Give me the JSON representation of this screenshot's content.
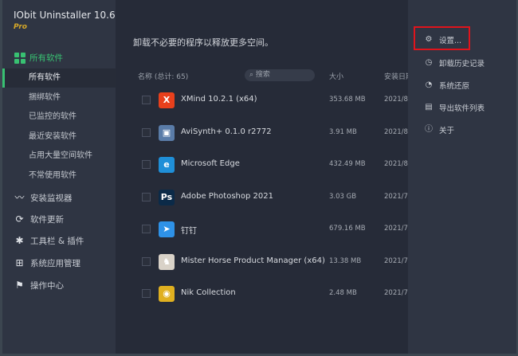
{
  "app": {
    "title": "IObit Uninstaller 10.6",
    "edition": "Pro"
  },
  "sidebar": {
    "group": "所有软件",
    "sub_items": [
      "所有软件",
      "捆绑软件",
      "已监控的软件",
      "最近安装软件",
      "占用大量空间软件",
      "不常使用软件"
    ],
    "items": [
      {
        "label": "安装监视器",
        "icon": "chart-icon"
      },
      {
        "label": "软件更新",
        "icon": "refresh-icon"
      },
      {
        "label": "工具栏 & 插件",
        "icon": "puzzle-icon"
      },
      {
        "label": "系统应用管理",
        "icon": "windows-icon"
      },
      {
        "label": "操作中心",
        "icon": "flag-icon"
      }
    ]
  },
  "main": {
    "description": "卸载不必要的程序以释放更多空间。",
    "columns": {
      "name": "名称 (总计: 65)",
      "search_placeholder": "搜索",
      "size": "大小",
      "date": "安装日期"
    },
    "rows": [
      {
        "name": "XMind 10.2.1 (x64)",
        "size": "353.68 MB",
        "date": "2021/8/",
        "icon": "X",
        "color": "#e8401c"
      },
      {
        "name": "AviSynth+ 0.1.0 r2772",
        "size": "3.91 MB",
        "date": "2021/8/",
        "icon": "▣",
        "color": "#5a7ca8"
      },
      {
        "name": "Microsoft Edge",
        "size": "432.49 MB",
        "date": "2021/8/",
        "icon": "e",
        "color": "#1f8fd8"
      },
      {
        "name": "Adobe Photoshop 2021",
        "size": "3.03 GB",
        "date": "2021/7/",
        "icon": "Ps",
        "color": "#0b2a48"
      },
      {
        "name": "钉钉",
        "size": "679.16 MB",
        "date": "2021/7/",
        "icon": "➤",
        "color": "#2e92e8"
      },
      {
        "name": "Mister Horse Product Manager (x64)",
        "size": "13.38 MB",
        "date": "2021/7/",
        "icon": "♞",
        "color": "#d9d2c8"
      },
      {
        "name": "Nik Collection",
        "size": "2.48 MB",
        "date": "2021/7/",
        "icon": "◉",
        "color": "#e0b020"
      }
    ]
  },
  "menu": {
    "items": [
      "设置...",
      "卸载历史记录",
      "系统还原",
      "导出软件列表",
      "关于"
    ]
  },
  "colors": {
    "accent": "#38c172",
    "highlight": "#e0141c"
  }
}
